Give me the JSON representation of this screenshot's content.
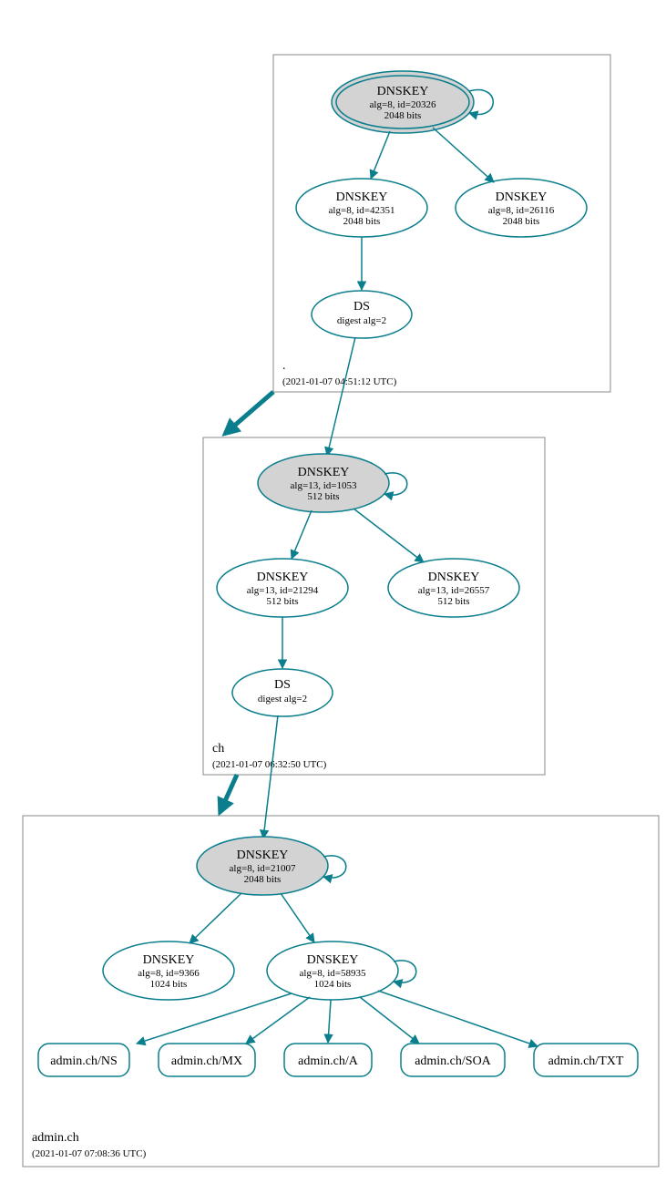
{
  "zones": {
    "root": {
      "name": ".",
      "timestamp": "(2021-01-07 04:51:12 UTC)"
    },
    "ch": {
      "name": "ch",
      "timestamp": "(2021-01-07 06:32:50 UTC)"
    },
    "admin": {
      "name": "admin.ch",
      "timestamp": "(2021-01-07 07:08:36 UTC)"
    }
  },
  "nodes": {
    "root_ksk": {
      "title": "DNSKEY",
      "line1": "alg=8, id=20326",
      "line2": "2048 bits"
    },
    "root_zsk1": {
      "title": "DNSKEY",
      "line1": "alg=8, id=42351",
      "line2": "2048 bits"
    },
    "root_zsk2": {
      "title": "DNSKEY",
      "line1": "alg=8, id=26116",
      "line2": "2048 bits"
    },
    "root_ds": {
      "title": "DS",
      "line1": "digest alg=2"
    },
    "ch_ksk": {
      "title": "DNSKEY",
      "line1": "alg=13, id=1053",
      "line2": "512 bits"
    },
    "ch_zsk1": {
      "title": "DNSKEY",
      "line1": "alg=13, id=21294",
      "line2": "512 bits"
    },
    "ch_zsk2": {
      "title": "DNSKEY",
      "line1": "alg=13, id=26557",
      "line2": "512 bits"
    },
    "ch_ds": {
      "title": "DS",
      "line1": "digest alg=2"
    },
    "admin_ksk": {
      "title": "DNSKEY",
      "line1": "alg=8, id=21007",
      "line2": "2048 bits"
    },
    "admin_zsk1": {
      "title": "DNSKEY",
      "line1": "alg=8, id=9366",
      "line2": "1024 bits"
    },
    "admin_zsk2": {
      "title": "DNSKEY",
      "line1": "alg=8, id=58935",
      "line2": "1024 bits"
    },
    "rr_ns": {
      "label": "admin.ch/NS"
    },
    "rr_mx": {
      "label": "admin.ch/MX"
    },
    "rr_a": {
      "label": "admin.ch/A"
    },
    "rr_soa": {
      "label": "admin.ch/SOA"
    },
    "rr_txt": {
      "label": "admin.ch/TXT"
    }
  }
}
